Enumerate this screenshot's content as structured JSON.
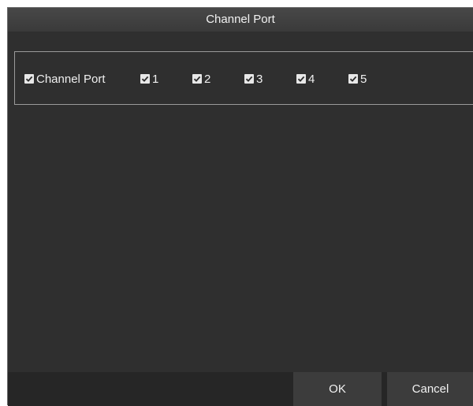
{
  "dialog": {
    "title": "Channel Port"
  },
  "channel_port": {
    "main": {
      "label": "Channel Port",
      "checked": true
    },
    "channels": [
      {
        "label": "1",
        "checked": true
      },
      {
        "label": "2",
        "checked": true
      },
      {
        "label": "3",
        "checked": true
      },
      {
        "label": "4",
        "checked": true
      },
      {
        "label": "5",
        "checked": true
      }
    ]
  },
  "footer": {
    "ok_label": "OK",
    "cancel_label": "Cancel"
  },
  "colors": {
    "dialog_bg": "#2f2f2f",
    "title_bg": "#404040",
    "button_bg": "#3c3c3c",
    "text": "#f0f0f0"
  },
  "icons": {
    "checkbox": "checkbox-checked-icon"
  }
}
